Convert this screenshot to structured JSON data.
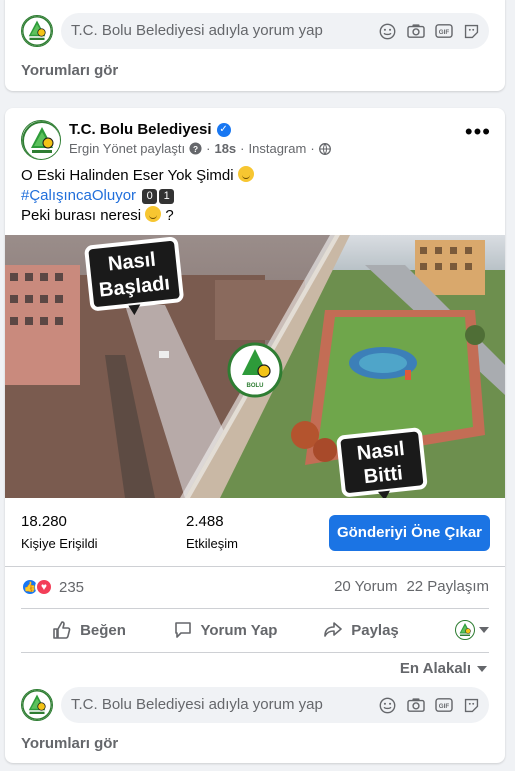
{
  "top_comment": {
    "placeholder": "T.C. Bolu Belediyesi adıyla yorum yap",
    "see_comments": "Yorumları gör"
  },
  "post": {
    "page_name": "T.C. Bolu Belediyesi",
    "shared_by": "Ergin Yönet paylaştı",
    "time": "18s",
    "source": "Instagram",
    "text_line1": "O Eski Halinden Eser Yok Şimdi",
    "hashtag": "#ÇalışıncaOluyor",
    "digits": [
      "0",
      "1"
    ],
    "text_line3": "Peki burası neresi",
    "text_line3_suffix": "?",
    "image": {
      "sticker_top_line1": "Nasıl",
      "sticker_top_line2": "Başladı",
      "sticker_bottom_line1": "Nasıl",
      "sticker_bottom_line2": "Bitti",
      "logo_text": "BOLU"
    }
  },
  "insights": {
    "reach_value": "18.280",
    "reach_label": "Kişiye Erişildi",
    "engagement_value": "2.488",
    "engagement_label": "Etkileşim",
    "boost_label": "Gönderiyi Öne Çıkar"
  },
  "reactions": {
    "count": "235",
    "comments": "20 Yorum",
    "shares": "22 Paylaşım"
  },
  "actions": {
    "like": "Beğen",
    "comment": "Yorum Yap",
    "share": "Paylaş"
  },
  "sort_label": "En Alakalı",
  "bottom_comment": {
    "placeholder": "T.C. Bolu Belediyesi adıyla yorum yap",
    "see_comments": "Yorumları gör"
  },
  "colors": {
    "accent": "#1b74e4",
    "hashtag": "#216fdb",
    "like": "#1877f2",
    "love": "#f33e58"
  }
}
